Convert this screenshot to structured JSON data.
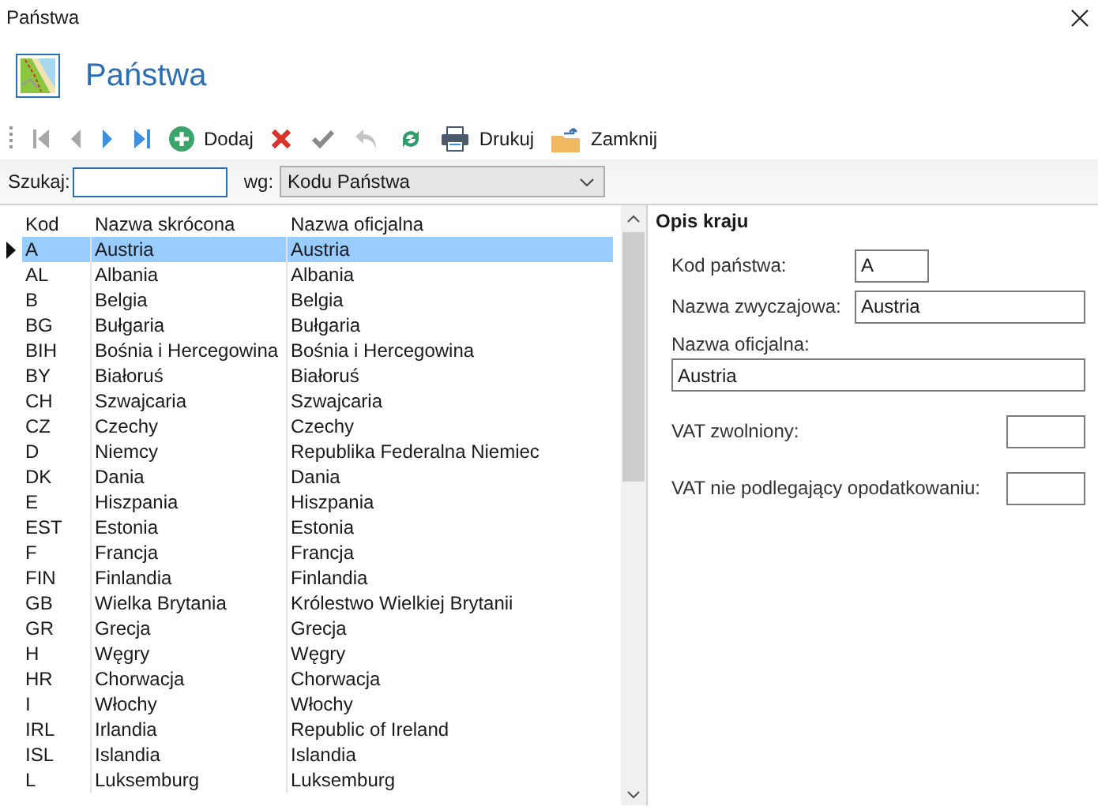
{
  "window": {
    "title": "Państwa"
  },
  "header": {
    "title": "Państwa"
  },
  "toolbar": [
    {
      "kind": "first",
      "disabled": true
    },
    {
      "kind": "prev",
      "disabled": true
    },
    {
      "kind": "next",
      "disabled": false
    },
    {
      "kind": "last",
      "disabled": false
    },
    {
      "kind": "add",
      "label": "Dodaj",
      "disabled": false
    },
    {
      "kind": "delete",
      "disabled": false
    },
    {
      "kind": "confirm",
      "disabled": true
    },
    {
      "kind": "undo",
      "disabled": true
    },
    {
      "kind": "refresh",
      "disabled": false
    },
    {
      "kind": "print",
      "label": "Drukuj",
      "disabled": false
    },
    {
      "kind": "close",
      "label": "Zamknij",
      "disabled": false
    }
  ],
  "search": {
    "label": "Szukaj:",
    "by_label": "wg:",
    "by_value": "Kodu Państwa"
  },
  "table": {
    "columns": [
      "Kod",
      "Nazwa skrócona",
      "Nazwa oficjalna"
    ],
    "rows": [
      {
        "cells": [
          "A",
          "Austria",
          "Austria"
        ],
        "selected": true
      },
      {
        "cells": [
          "AL",
          "Albania",
          "Albania"
        ],
        "selected": false
      },
      {
        "cells": [
          "B",
          "Belgia",
          "Belgia"
        ],
        "selected": false
      },
      {
        "cells": [
          "BG",
          "Bułgaria",
          "Bułgaria"
        ],
        "selected": false
      },
      {
        "cells": [
          "BIH",
          "Bośnia i Hercegowina",
          "Bośnia i Hercegowina"
        ],
        "selected": false
      },
      {
        "cells": [
          "BY",
          "Białoruś",
          "Białoruś"
        ],
        "selected": false
      },
      {
        "cells": [
          "CH",
          "Szwajcaria",
          "Szwajcaria"
        ],
        "selected": false
      },
      {
        "cells": [
          "CZ",
          "Czechy",
          "Czechy"
        ],
        "selected": false
      },
      {
        "cells": [
          "D",
          "Niemcy",
          "Republika Federalna Niemiec"
        ],
        "selected": false
      },
      {
        "cells": [
          "DK",
          "Dania",
          "Dania"
        ],
        "selected": false
      },
      {
        "cells": [
          "E",
          "Hiszpania",
          "Hiszpania"
        ],
        "selected": false
      },
      {
        "cells": [
          "EST",
          "Estonia",
          "Estonia"
        ],
        "selected": false
      },
      {
        "cells": [
          "F",
          "Francja",
          "Francja"
        ],
        "selected": false
      },
      {
        "cells": [
          "FIN",
          "Finlandia",
          "Finlandia"
        ],
        "selected": false
      },
      {
        "cells": [
          "GB",
          "Wielka Brytania",
          "Królestwo Wielkiej Brytanii"
        ],
        "selected": false
      },
      {
        "cells": [
          "GR",
          "Grecja",
          "Grecja"
        ],
        "selected": false
      },
      {
        "cells": [
          "H",
          "Węgry",
          "Węgry"
        ],
        "selected": false
      },
      {
        "cells": [
          "HR",
          "Chorwacja",
          "Chorwacja"
        ],
        "selected": false
      },
      {
        "cells": [
          "I",
          "Włochy",
          "Włochy"
        ],
        "selected": false
      },
      {
        "cells": [
          "IRL",
          "Irlandia",
          "Republic of Ireland"
        ],
        "selected": false
      },
      {
        "cells": [
          "ISL",
          "Islandia",
          "Islandia"
        ],
        "selected": false
      },
      {
        "cells": [
          "L",
          "Luksemburg",
          "Luksemburg"
        ],
        "selected": false
      }
    ]
  },
  "details": {
    "title": "Opis kraju",
    "fields": [
      {
        "kind": "short",
        "label": "Kod państwa:",
        "value": "A"
      },
      {
        "kind": "inline",
        "label": "Nazwa zwyczajowa:",
        "value": "Austria"
      },
      {
        "kind": "stacked",
        "label": "Nazwa oficjalna:",
        "value": "Austria"
      },
      {
        "kind": "small",
        "label": "VAT zwolniony:"
      },
      {
        "kind": "small",
        "label": "VAT nie podlegający opodatkowaniu:"
      }
    ]
  }
}
